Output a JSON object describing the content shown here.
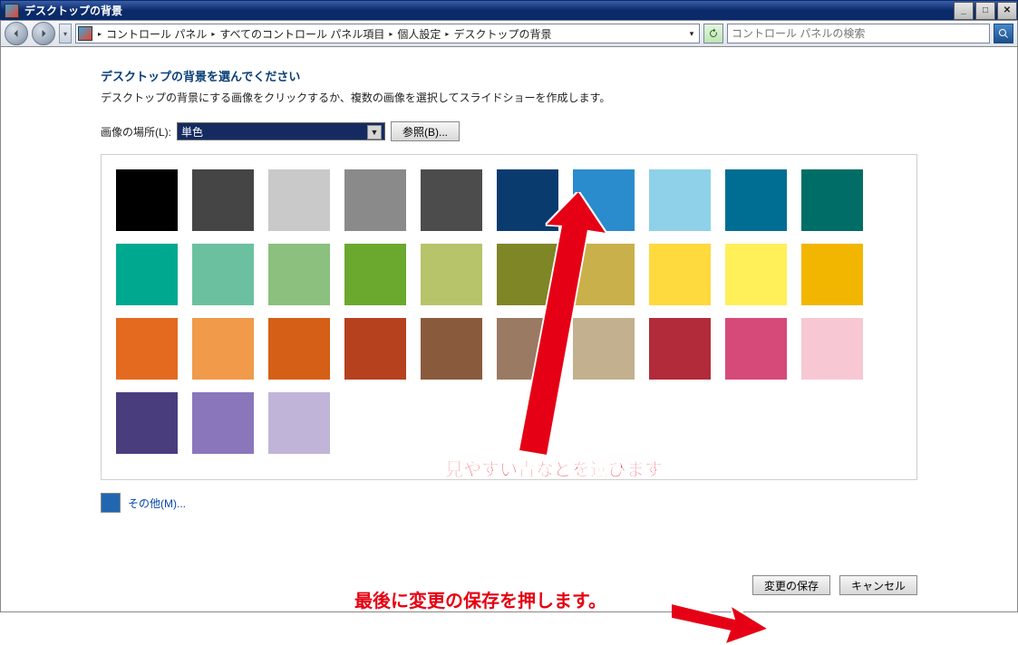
{
  "titlebar": {
    "title": "デスクトップの背景"
  },
  "breadcrumb": {
    "items": [
      "コントロール パネル",
      "すべてのコントロール パネル項目",
      "個人設定",
      "デスクトップの背景"
    ]
  },
  "search": {
    "placeholder": "コントロール パネルの検索"
  },
  "heading": "デスクトップの背景を選んでください",
  "subheading": "デスクトップの背景にする画像をクリックするか、複数の画像を選択してスライドショーを作成します。",
  "location": {
    "label": "画像の場所(L):",
    "selected": "単色",
    "browse": "参照(B)..."
  },
  "palette": [
    "#000000",
    "#454545",
    "#c9c9c9",
    "#8a8a8a",
    "#4c4c4c",
    "#0a3b6e",
    "#2a8ccc",
    "#8fd1e9",
    "#006e93",
    "#006e66",
    "#00a88f",
    "#6bc19f",
    "#8bc07e",
    "#6ba82e",
    "#b7c46a",
    "#7f8626",
    "#c9b04a",
    "#ffda3e",
    "#fff05a",
    "#f3b600",
    "#e46a1f",
    "#f09a4a",
    "#d55f17",
    "#b5411f",
    "#8a5a3d",
    "#9a7a63",
    "#c2b08e",
    "#b22b3a",
    "#d64a7a",
    "#f7c8d4",
    "#4a3d7d",
    "#8a77bb",
    "#c1b4d9"
  ],
  "others": {
    "label": "その他(M)...",
    "swatch": "#2166b0"
  },
  "buttons": {
    "save": "変更の保存",
    "cancel": "キャンセル"
  },
  "annotations": {
    "a1": "見やすい青などを選びます。",
    "a2": "最後に変更の保存を押します。"
  }
}
